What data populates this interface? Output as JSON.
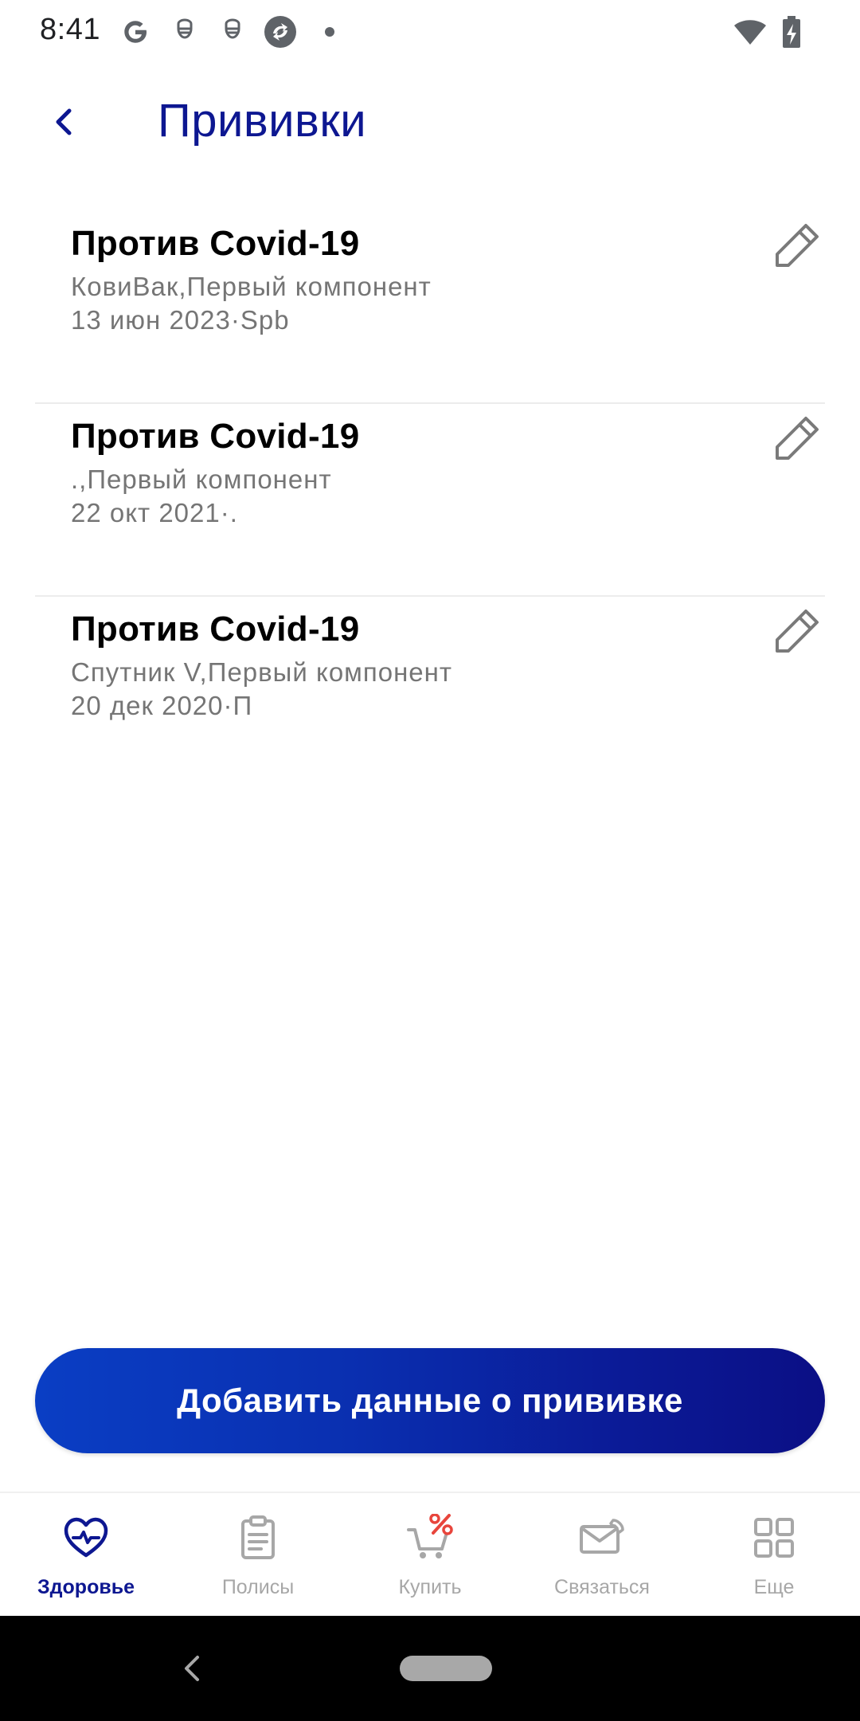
{
  "status_bar": {
    "time": "8:41",
    "icons": [
      "google-g-icon",
      "mask-icon",
      "mask-icon",
      "sync-app-icon",
      "notification-dot-icon",
      "wifi-icon",
      "battery-charging-icon"
    ]
  },
  "header": {
    "title": "Прививки",
    "back_icon": "chevron-left-icon"
  },
  "vaccinations": [
    {
      "title": "Против Covid-19",
      "detail": "КовиВак,Первый компонент",
      "date": "13 июн 2023·Spb",
      "edit_icon": "pencil-icon"
    },
    {
      "title": "Против Covid-19",
      "detail": ".,Первый компонент",
      "date": "22 окт 2021·.",
      "edit_icon": "pencil-icon"
    },
    {
      "title": "Против Covid-19",
      "detail": "Спутник V,Первый компонент",
      "date": "20 дек 2020·П",
      "edit_icon": "pencil-icon"
    }
  ],
  "add_button": {
    "label": "Добавить данные о прививке"
  },
  "bottom_nav": {
    "items": [
      {
        "label": "Здоровье",
        "icon": "heart-pulse-icon",
        "active": true
      },
      {
        "label": "Полисы",
        "icon": "clipboard-icon",
        "active": false
      },
      {
        "label": "Купить",
        "icon": "cart-percent-icon",
        "active": false
      },
      {
        "label": "Связаться",
        "icon": "envelope-phone-icon",
        "active": false
      },
      {
        "label": "Еще",
        "icon": "grid-icon",
        "active": false
      }
    ]
  },
  "colors": {
    "brand": "#0d1791",
    "button_gradient_start": "#0a3ec4",
    "button_gradient_end": "#0b0f85",
    "secondary_text": "#757575",
    "inactive_nav": "#a7a7a7",
    "sale_accent": "#e8453c"
  }
}
